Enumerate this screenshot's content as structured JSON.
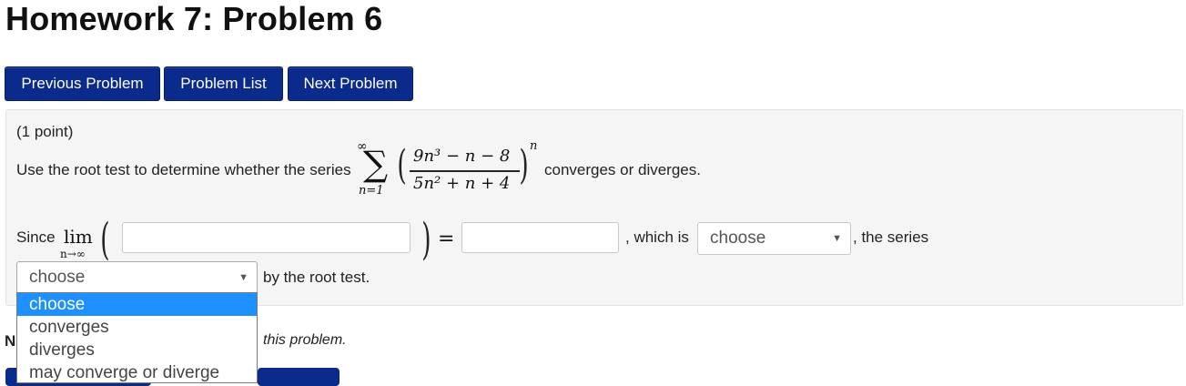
{
  "page": {
    "title": "Homework 7: Problem 6"
  },
  "nav": {
    "previous_label": "Previous Problem",
    "list_label": "Problem List",
    "next_label": "Next Problem"
  },
  "problem": {
    "points": "(1 point)",
    "prompt_prefix": "Use the root test to determine whether the series",
    "prompt_suffix": "converges or diverges.",
    "series": {
      "sum_upper": "∞",
      "sum_lower": "n=1",
      "numerator": "9n³ − n − 8",
      "denominator": "5n² + n + 4",
      "exponent": "n"
    },
    "since_label": "Since",
    "lim_label": "lim",
    "lim_sub": "n→∞",
    "equals": "=",
    "which_is": ", which is",
    "the_series": ", the series",
    "by_root_test": "by the root test.",
    "answer1_value": "",
    "answer2_value": "",
    "select1": {
      "selected": "choose"
    },
    "select2": {
      "selected": "choose",
      "options": [
        "choose",
        "converges",
        "diverges",
        "may converge or diverge"
      ]
    }
  },
  "footer": {
    "note_fragment": "this problem."
  }
}
